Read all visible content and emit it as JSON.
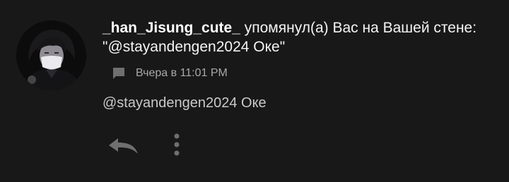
{
  "notification": {
    "username": "_han_Jisung_cute_",
    "action_text": " упомянул(а) Вас на Вашей стене: \"@stayandengen2024 Оке\"",
    "time": "Вчера в 11:01 PM",
    "quote_text": "@stayandengen2024 Оке"
  },
  "icons": {
    "meta": "comment-icon",
    "reply": "reply-icon",
    "more": "more-vertical-icon"
  },
  "colors": {
    "background": "#191818",
    "primary_text": "#f4f4f4",
    "secondary_text": "#a9a9a9",
    "icon": "#6f6f6f"
  }
}
